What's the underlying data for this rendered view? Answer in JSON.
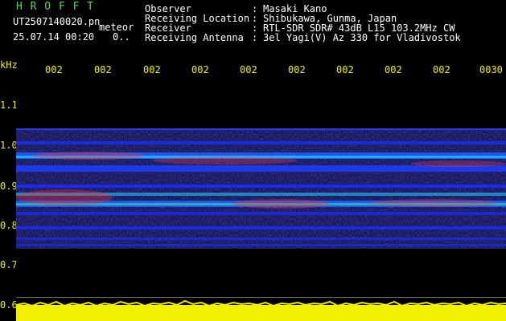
{
  "header": {
    "brand": "H R O F F T",
    "filename": "UT2507140020.pn",
    "file_tag": "meteor",
    "datetime": "25.07.14 00:20",
    "counter": "0..",
    "fields": [
      {
        "label": "Observer",
        "sep": ":",
        "value": "Masaki Kano"
      },
      {
        "label": "Receiving Location",
        "sep": ":",
        "value": "Shibukawa, Gunma, Japan"
      },
      {
        "label": "Receiver",
        "sep": ":",
        "value": "RTL-SDR SDR# 43dB L15 103.2MHz CW"
      },
      {
        "label": "Receiving Antenna",
        "sep": ":",
        "value": "3el Yagi(V) Az 330 for Vladivostok"
      }
    ]
  },
  "axes": {
    "y_unit": "kHz",
    "x_ticks": [
      "002",
      "002",
      "002",
      "002",
      "002",
      "002",
      "002",
      "002",
      "002",
      "0030"
    ],
    "y_ticks": [
      "1.1",
      "1.0",
      "0.9",
      "0.8",
      "0.7",
      "0.6"
    ]
  },
  "colors": {
    "background": "#000000",
    "header_green": "#5ad25a",
    "axis_yellow": "#f0f000",
    "signal_blue": "#1a2cff",
    "signal_red": "#ff3030"
  }
}
